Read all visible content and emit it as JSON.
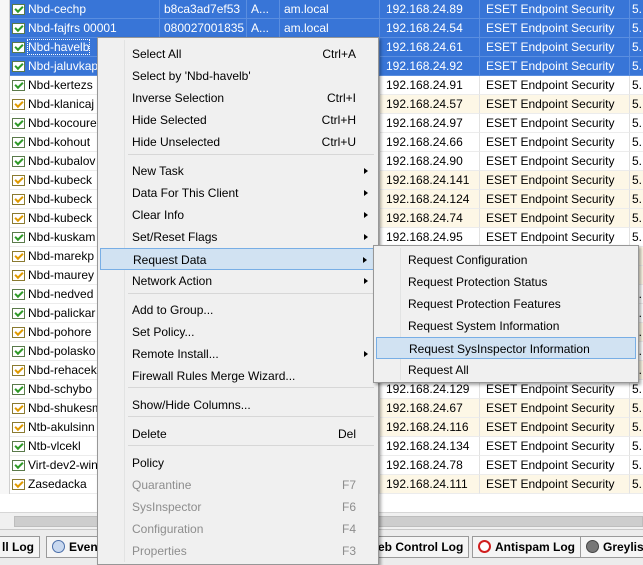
{
  "table": {
    "rows": [
      {
        "name": "Nbd-cechp",
        "mac": "b8ca3ad7ef53",
        "a": "A...",
        "domain": "am.local",
        "ip": "192.168.24.89",
        "product": "ESET Endpoint Security",
        "ver": "5.",
        "selected": true
      },
      {
        "name": "Nbd-fajfrs 00001",
        "mac": "080027001835",
        "a": "A...",
        "domain": "am.local",
        "ip": "192.168.24.54",
        "product": "ESET Endpoint Security",
        "ver": "5.",
        "selected": true
      },
      {
        "name": "Nbd-havelb",
        "mac": "",
        "a": "",
        "domain": "",
        "ip": "192.168.24.61",
        "product": "ESET Endpoint Security",
        "ver": "5.",
        "selected": true,
        "focused": true
      },
      {
        "name": "Nbd-jaluvkap",
        "mac": "",
        "a": "",
        "domain": "",
        "ip": "192.168.24.92",
        "product": "ESET Endpoint Security",
        "ver": "5.",
        "selected": true
      },
      {
        "name": "Nbd-kertezs",
        "ip": "192.168.24.91",
        "product": "ESET Endpoint Security",
        "ver": "5."
      },
      {
        "name": "Nbd-klanicaj",
        "ip": "192.168.24.57",
        "product": "ESET Endpoint Security",
        "ver": "5.",
        "alt": true
      },
      {
        "name": "Nbd-kocoure",
        "ip": "192.168.24.97",
        "product": "ESET Endpoint Security",
        "ver": "5."
      },
      {
        "name": "Nbd-kohout",
        "ip": "192.168.24.66",
        "product": "ESET Endpoint Security",
        "ver": "5."
      },
      {
        "name": "Nbd-kubalov",
        "ip": "192.168.24.90",
        "product": "ESET Endpoint Security",
        "ver": "5."
      },
      {
        "name": "Nbd-kubeck",
        "ip": "192.168.24.141",
        "product": "ESET Endpoint Security",
        "ver": "5.",
        "alt": true
      },
      {
        "name": "Nbd-kubeck",
        "ip": "192.168.24.124",
        "product": "ESET Endpoint Security",
        "ver": "5.",
        "alt": true
      },
      {
        "name": "Nbd-kubeck",
        "ip": "192.168.24.74",
        "product": "ESET Endpoint Security",
        "ver": "5.",
        "alt": true
      },
      {
        "name": "Nbd-kuskam",
        "ip": "192.168.24.95",
        "product": "ESET Endpoint Security",
        "ver": "5."
      },
      {
        "name": "Nbd-marekp",
        "ip": "",
        "product": "",
        "ver": "",
        "alt": true
      },
      {
        "name": "Nbd-maurey",
        "ip": "",
        "product": "",
        "ver": "",
        "alt": true
      },
      {
        "name": "Nbd-nedved",
        "ip": "",
        "product": "",
        "ver": "5."
      },
      {
        "name": "Nbd-palickar",
        "ip": "",
        "product": "",
        "ver": "5."
      },
      {
        "name": "Nbd-pohore",
        "ip": "",
        "product": "",
        "ver": "5.",
        "alt": true
      },
      {
        "name": "Nbd-polasko",
        "ip": "",
        "product": "",
        "ver": "5."
      },
      {
        "name": "Nbd-rehacek",
        "ip": "",
        "product": "",
        "ver": "5.",
        "alt": true
      },
      {
        "name": "Nbd-schybo",
        "ip": "192.168.24.129",
        "product": "ESET Endpoint Security",
        "ver": "5."
      },
      {
        "name": "Nbd-shukesm",
        "ip": "192.168.24.67",
        "product": "ESET Endpoint Security",
        "ver": "5.",
        "alt": true
      },
      {
        "name": "Ntb-akulsinn",
        "ip": "192.168.24.116",
        "product": "ESET Endpoint Security",
        "ver": "5.",
        "alt": true
      },
      {
        "name": "Ntb-vlcekl",
        "ip": "192.168.24.134",
        "product": "ESET Endpoint Security",
        "ver": "5."
      },
      {
        "name": "Virt-dev2-win",
        "ip": "192.168.24.78",
        "product": "ESET Endpoint Security",
        "ver": "5."
      },
      {
        "name": "Zasedacka",
        "ip": "192.168.24.111",
        "product": "ESET Endpoint Security",
        "ver": "5.",
        "alt": true
      }
    ]
  },
  "bottom_tabs": [
    {
      "label": "ll Log",
      "icon": "log-icon"
    },
    {
      "label": "Event",
      "icon": "event-icon"
    },
    {
      "label": "eb Control Log",
      "icon": "web-control-icon"
    },
    {
      "label": "Antispam Log",
      "icon": "antispam-icon"
    },
    {
      "label": "Greylist",
      "icon": "greylist-icon"
    }
  ],
  "context_menu": {
    "items": [
      {
        "label": "Select All",
        "shortcut": "Ctrl+A"
      },
      {
        "label": "Select by 'Nbd-havelb'",
        "shortcut": ""
      },
      {
        "label": "Inverse Selection",
        "shortcut": "Ctrl+I"
      },
      {
        "label": "Hide Selected",
        "shortcut": "Ctrl+H"
      },
      {
        "label": "Hide Unselected",
        "shortcut": "Ctrl+U"
      },
      {
        "label": "New Task",
        "submenu": true
      },
      {
        "label": "Data For This Client",
        "submenu": true
      },
      {
        "label": "Clear Info",
        "submenu": true
      },
      {
        "label": "Set/Reset Flags",
        "submenu": true
      },
      {
        "label": "Request Data",
        "submenu": true,
        "highlighted": true
      },
      {
        "label": "Network Action",
        "submenu": true
      },
      {
        "label": "Add to Group..."
      },
      {
        "label": "Set Policy..."
      },
      {
        "label": "Remote Install...",
        "submenu": true
      },
      {
        "label": "Firewall Rules Merge Wizard..."
      },
      {
        "label": "Show/Hide Columns..."
      },
      {
        "label": "Delete",
        "shortcut": "Del"
      },
      {
        "label": "Policy"
      },
      {
        "label": "Quarantine",
        "shortcut": "F7",
        "disabled": true
      },
      {
        "label": "SysInspector",
        "shortcut": "F6",
        "disabled": true
      },
      {
        "label": "Configuration",
        "shortcut": "F4",
        "disabled": true
      },
      {
        "label": "Properties",
        "shortcut": "F3",
        "disabled": true
      }
    ]
  },
  "submenu": {
    "items": [
      {
        "label": "Request Configuration"
      },
      {
        "label": "Request Protection Status"
      },
      {
        "label": "Request Protection Features"
      },
      {
        "label": "Request System Information"
      },
      {
        "label": "Request SysInspector Information",
        "highlighted": true
      },
      {
        "label": "Request All"
      }
    ]
  },
  "colors": {
    "selection": "#3875d7",
    "menu_highlight": "#d1e2f2",
    "alt_row": "#fdf7e6"
  }
}
